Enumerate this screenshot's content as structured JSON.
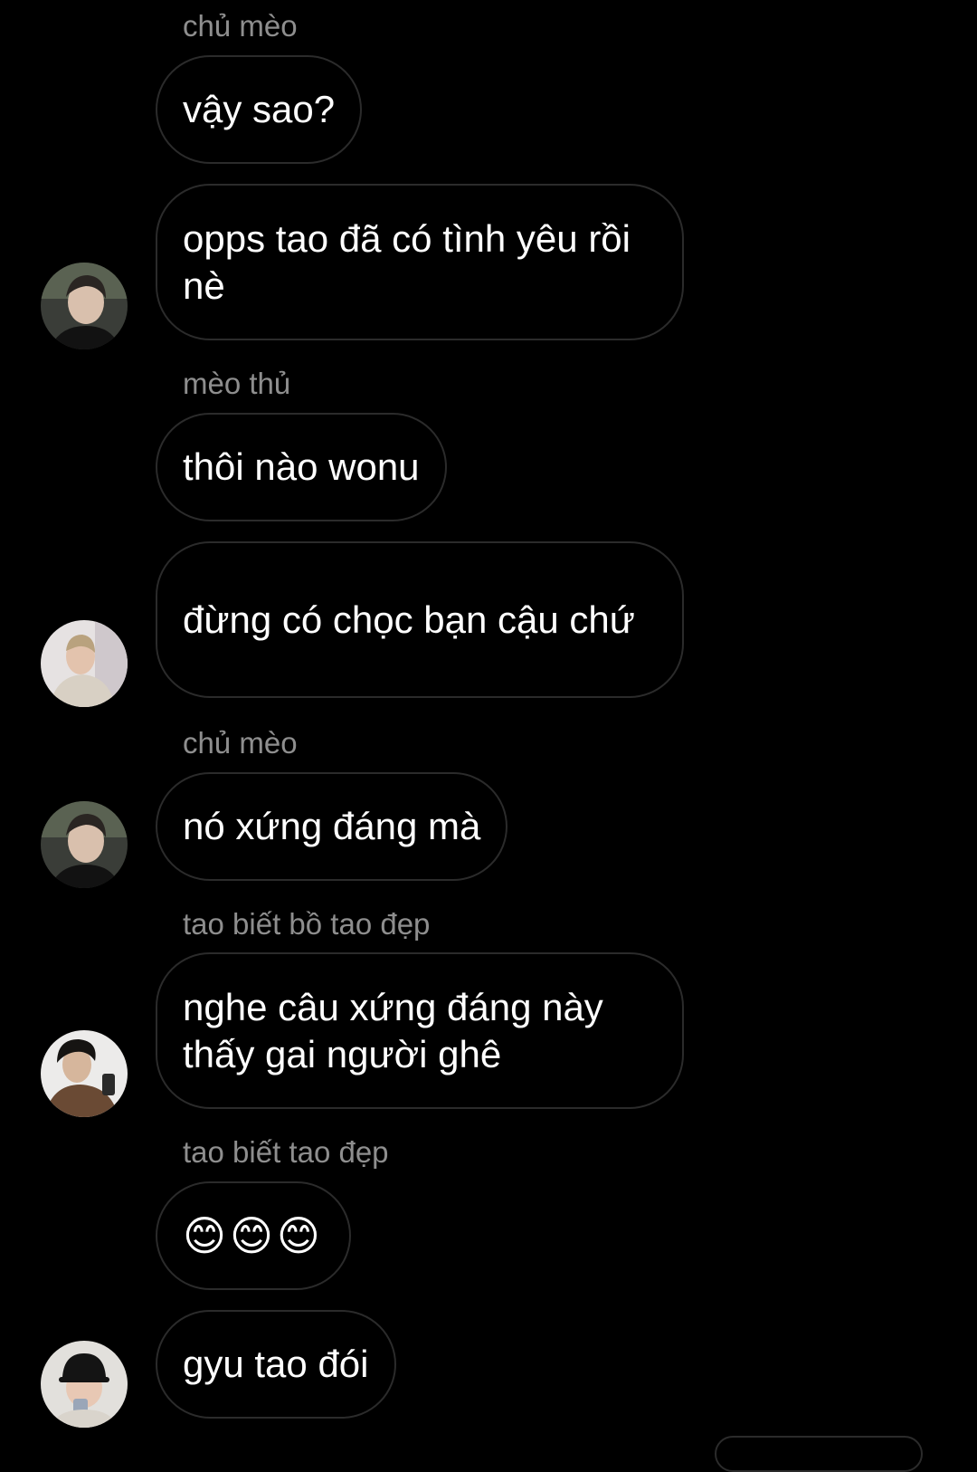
{
  "messages": [
    {
      "sender": "chủ mèo",
      "text": "vậy sao?"
    },
    {
      "text": "opps tao đã có tình yêu rồi nè"
    },
    {
      "sender": "mèo thủ",
      "text": "thôi nào wonu"
    },
    {
      "text": "đừng có chọc bạn cậu chứ"
    },
    {
      "sender": "chủ mèo",
      "text": "nó xứng đáng mà"
    },
    {
      "sender": "tao biết bồ tao đẹp",
      "text": "nghe câu xứng đáng này thấy gai người ghê"
    },
    {
      "sender": "tao biết tao đẹp",
      "text": "😊😊😊"
    },
    {
      "text": "gyu tao đói"
    }
  ],
  "avatars": [
    {
      "name": "avatar-chu-meo"
    },
    {
      "name": "avatar-meo-thu"
    },
    {
      "name": "avatar-chu-meo"
    },
    {
      "name": "avatar-tao-biet-bo-tao-dep"
    },
    {
      "name": "avatar-tao-biet-tao-dep"
    }
  ],
  "colors": {
    "background": "#000000",
    "bubble_border": "#2b2b2b",
    "sender_text": "#8e8e8e",
    "message_text": "#ffffff"
  }
}
